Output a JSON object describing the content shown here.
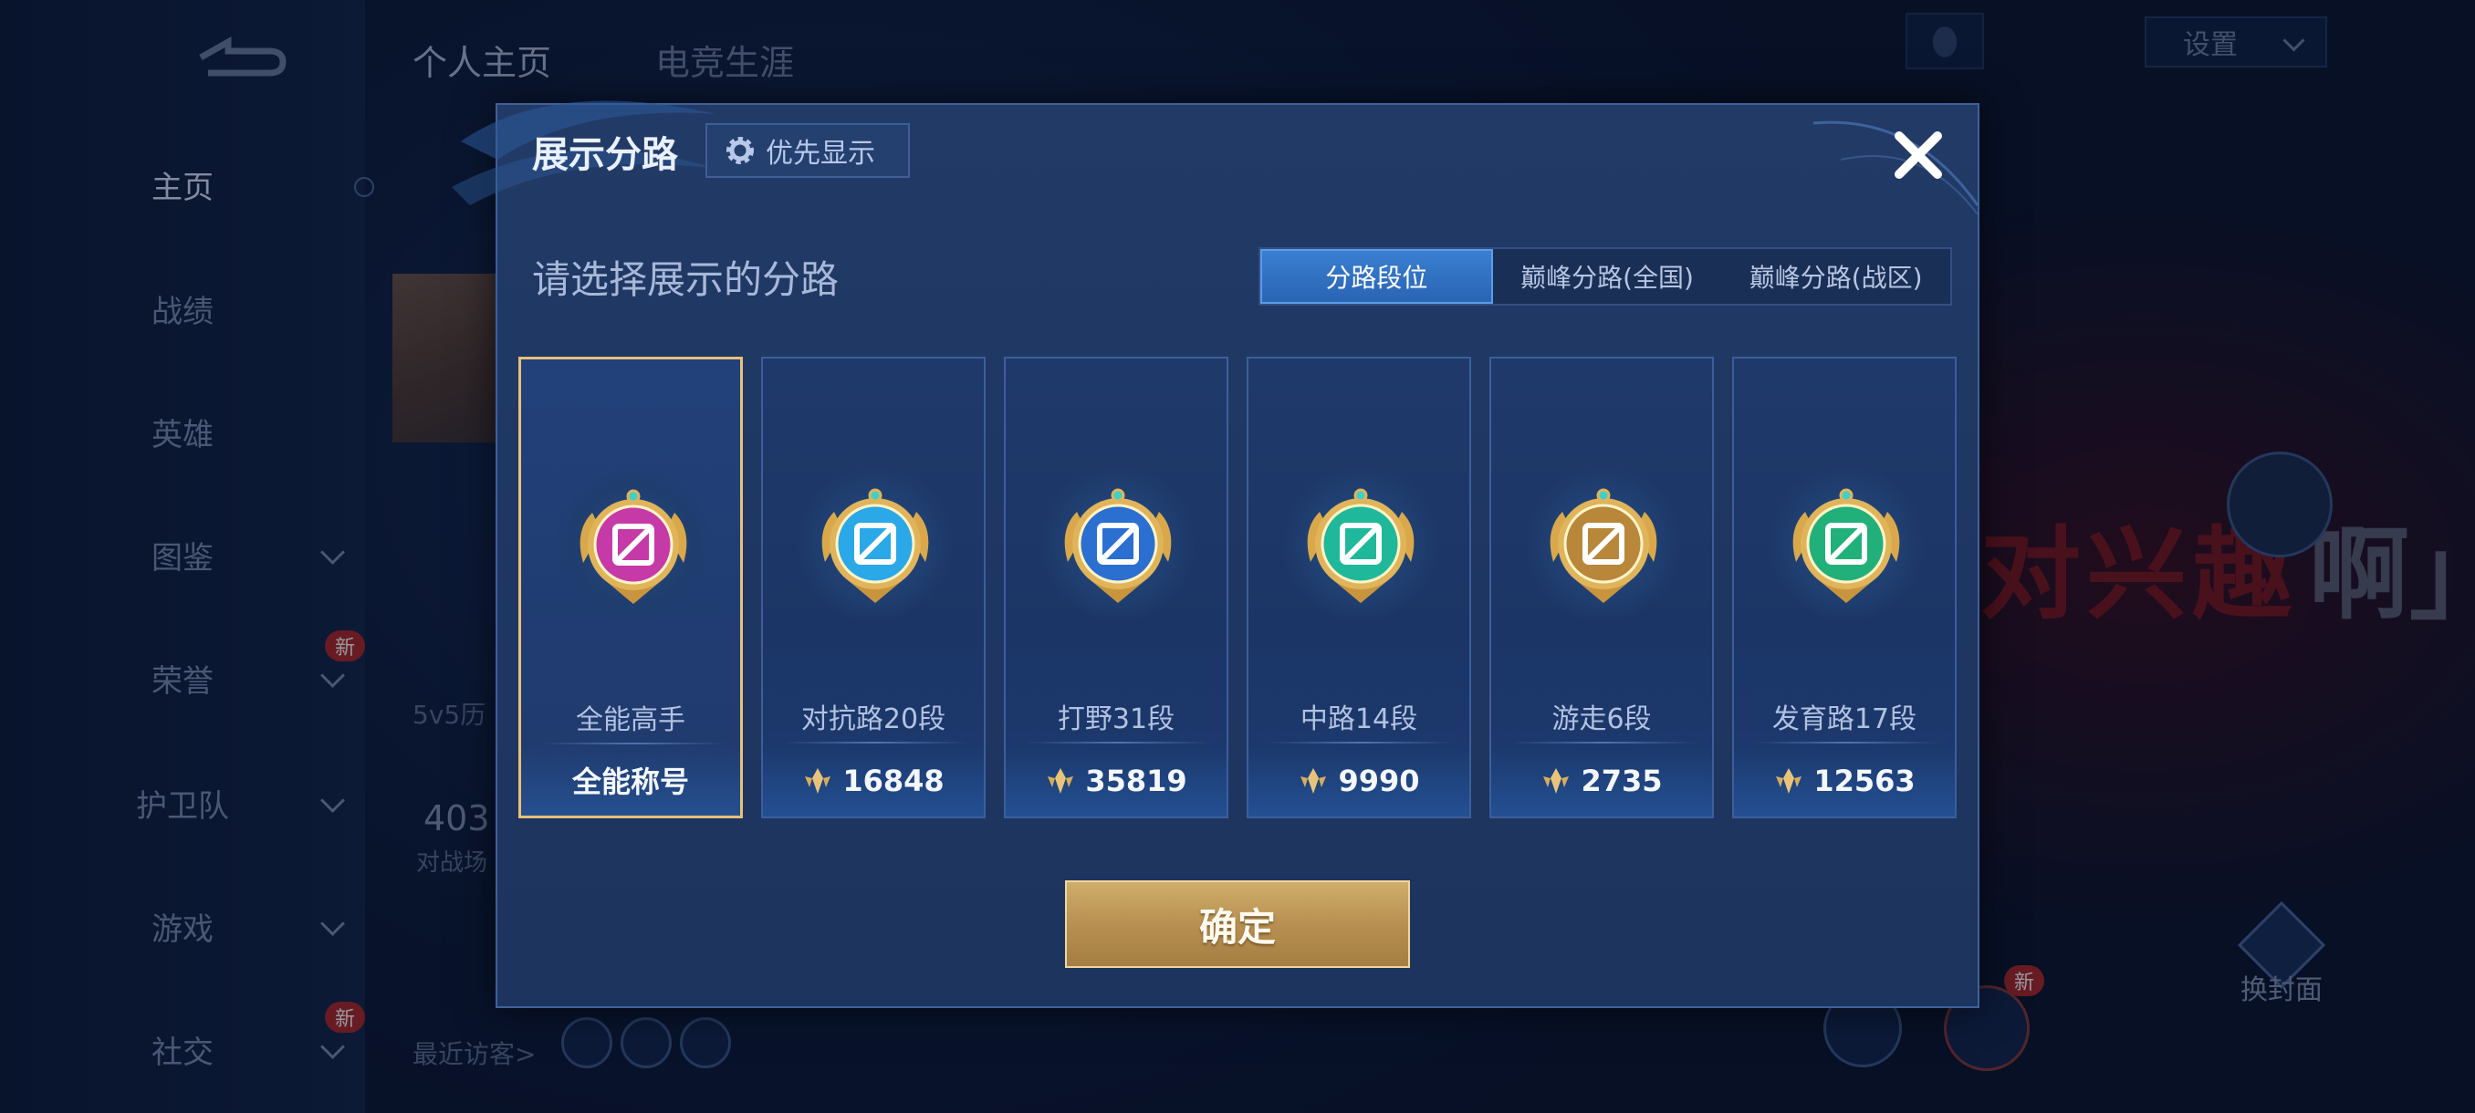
{
  "background": {
    "top_tabs": [
      "个人主页",
      "电竞生涯"
    ],
    "settings_label": "设置",
    "nav": [
      {
        "label": "主页",
        "active": true,
        "chevron": false,
        "new": false
      },
      {
        "label": "战绩",
        "active": false,
        "chevron": false,
        "new": false
      },
      {
        "label": "英雄",
        "active": false,
        "chevron": false,
        "new": false
      },
      {
        "label": "图鉴",
        "active": false,
        "chevron": true,
        "new": false
      },
      {
        "label": "荣誉",
        "active": false,
        "chevron": true,
        "new": true
      },
      {
        "label": "护卫队",
        "active": false,
        "chevron": true,
        "new": false
      },
      {
        "label": "游戏",
        "active": false,
        "chevron": true,
        "new": false
      },
      {
        "label": "社交",
        "active": false,
        "chevron": true,
        "new": true
      }
    ],
    "new_badge": "新",
    "history_text": "5v5历",
    "count_text": "403",
    "count_sub": "对战场",
    "visitors_label": "最近访客>",
    "slogan_red": "对兴趣",
    "slogan_grey": "啊」",
    "swap_cover_label": "换封面"
  },
  "modal": {
    "title": "展示分路",
    "priority_label": "优先显示",
    "subtitle": "请选择展示的分路",
    "tabs": [
      {
        "label": "分路段位",
        "active": true
      },
      {
        "label": "巅峰分路(全国)",
        "active": false
      },
      {
        "label": "巅峰分路(战区)",
        "active": false
      }
    ],
    "cards": [
      {
        "name": "全能高手",
        "value": "全能称号",
        "selected": true,
        "medal": "all-round-medal-icon",
        "color": "#c63aa8"
      },
      {
        "name": "对抗路20段",
        "value": "16848",
        "selected": false,
        "medal": "clash-lane-medal-icon",
        "color": "#2aa8e8"
      },
      {
        "name": "打野31段",
        "value": "35819",
        "selected": false,
        "medal": "jungle-medal-icon",
        "color": "#2b6fd0"
      },
      {
        "name": "中路14段",
        "value": "9990",
        "selected": false,
        "medal": "mid-lane-medal-icon",
        "color": "#20b89a"
      },
      {
        "name": "游走6段",
        "value": "2735",
        "selected": false,
        "medal": "roam-medal-icon",
        "color": "#b8873a"
      },
      {
        "name": "发育路17段",
        "value": "12563",
        "selected": false,
        "medal": "farm-lane-medal-icon",
        "color": "#22b07a"
      }
    ],
    "confirm_label": "确定"
  }
}
